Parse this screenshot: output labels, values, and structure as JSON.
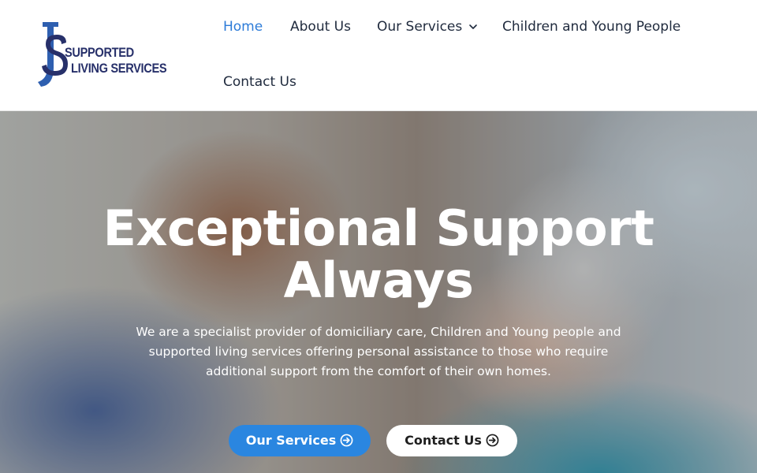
{
  "header": {
    "logo": {
      "line1": "SUPPORTED",
      "line2": "LIVING SERVICES",
      "monogram": "JS",
      "colors": {
        "navy": "#27306a",
        "blue": "#2e5fb0"
      }
    },
    "nav": {
      "items": [
        {
          "label": "Home",
          "active": true
        },
        {
          "label": "About Us",
          "active": false
        },
        {
          "label": "Our Services",
          "active": false,
          "dropdown": true,
          "icon": "chevron-down-icon"
        },
        {
          "label": "Children and Young People",
          "active": false
        },
        {
          "label": "Contact Us",
          "active": false
        }
      ],
      "active_color": "#2c7bd8",
      "text_color": "#1f2a3d"
    }
  },
  "hero": {
    "title": "Exceptional Support Always",
    "description": "We are a specialist provider of domiciliary care, Children and Young people and supported living services offering personal assistance to those who require additional support from the comfort of their own homes.",
    "buttons": [
      {
        "label": "Our Services",
        "icon": "arrow-circle-right-icon",
        "style": "primary",
        "color": "#2a86e0"
      },
      {
        "label": "Contact Us",
        "icon": "arrow-circle-right-icon",
        "style": "secondary",
        "color": "#ffffff"
      }
    ]
  }
}
